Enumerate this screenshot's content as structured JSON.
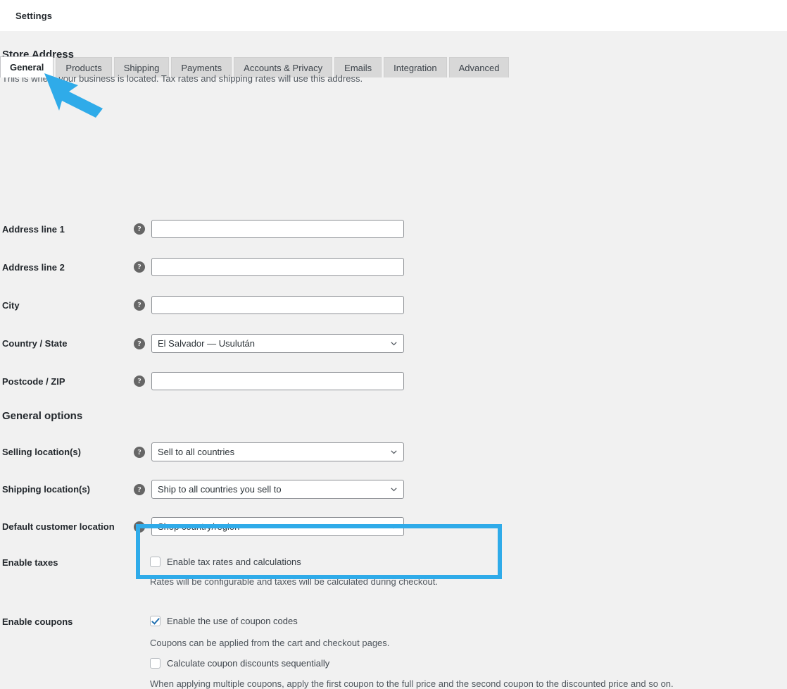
{
  "header": {
    "title": "Settings"
  },
  "tabs": [
    {
      "label": "General",
      "active": true
    },
    {
      "label": "Products",
      "active": false
    },
    {
      "label": "Shipping",
      "active": false
    },
    {
      "label": "Payments",
      "active": false
    },
    {
      "label": "Accounts & Privacy",
      "active": false
    },
    {
      "label": "Emails",
      "active": false
    },
    {
      "label": "Integration",
      "active": false
    },
    {
      "label": "Advanced",
      "active": false
    }
  ],
  "store_address": {
    "heading": "Store Address",
    "description": "This is where your business is located. Tax rates and shipping rates will use this address.",
    "help_glyph": "?",
    "fields": [
      {
        "label": "Address line 1",
        "type": "text",
        "value": "",
        "placeholder": ""
      },
      {
        "label": "Address line 2",
        "type": "text",
        "value": "",
        "placeholder": ""
      },
      {
        "label": "City",
        "type": "text",
        "value": "",
        "placeholder": ""
      },
      {
        "label": "Country / State",
        "type": "select",
        "value": "El Salvador — Usulután"
      },
      {
        "label": "Postcode / ZIP",
        "type": "text",
        "value": "",
        "placeholder": ""
      }
    ]
  },
  "general_options": {
    "heading": "General options",
    "selling_locations": {
      "label": "Selling location(s)",
      "value": "Sell to all countries"
    },
    "shipping_locations": {
      "label": "Shipping location(s)",
      "value": "Ship to all countries you sell to"
    },
    "default_customer_location": {
      "label": "Default customer location",
      "value": "Shop country/region"
    },
    "enable_taxes": {
      "label": "Enable taxes",
      "checkbox_label": "Enable tax rates and calculations",
      "checked": false,
      "description": "Rates will be configurable and taxes will be calculated during checkout."
    },
    "enable_coupons": {
      "label": "Enable coupons",
      "checkbox_label": "Enable the use of coupon codes",
      "checked": true,
      "description": "Coupons can be applied from the cart and checkout pages.",
      "sequential_label": "Calculate coupon discounts sequentially",
      "sequential_checked": false,
      "sequential_description": "When applying multiple coupons, apply the first coupon to the full price and the second coupon to the discounted price and so on."
    }
  },
  "annotations": {
    "highlight_color": "#2fabe9",
    "arrow_color": "#2fabe9"
  }
}
